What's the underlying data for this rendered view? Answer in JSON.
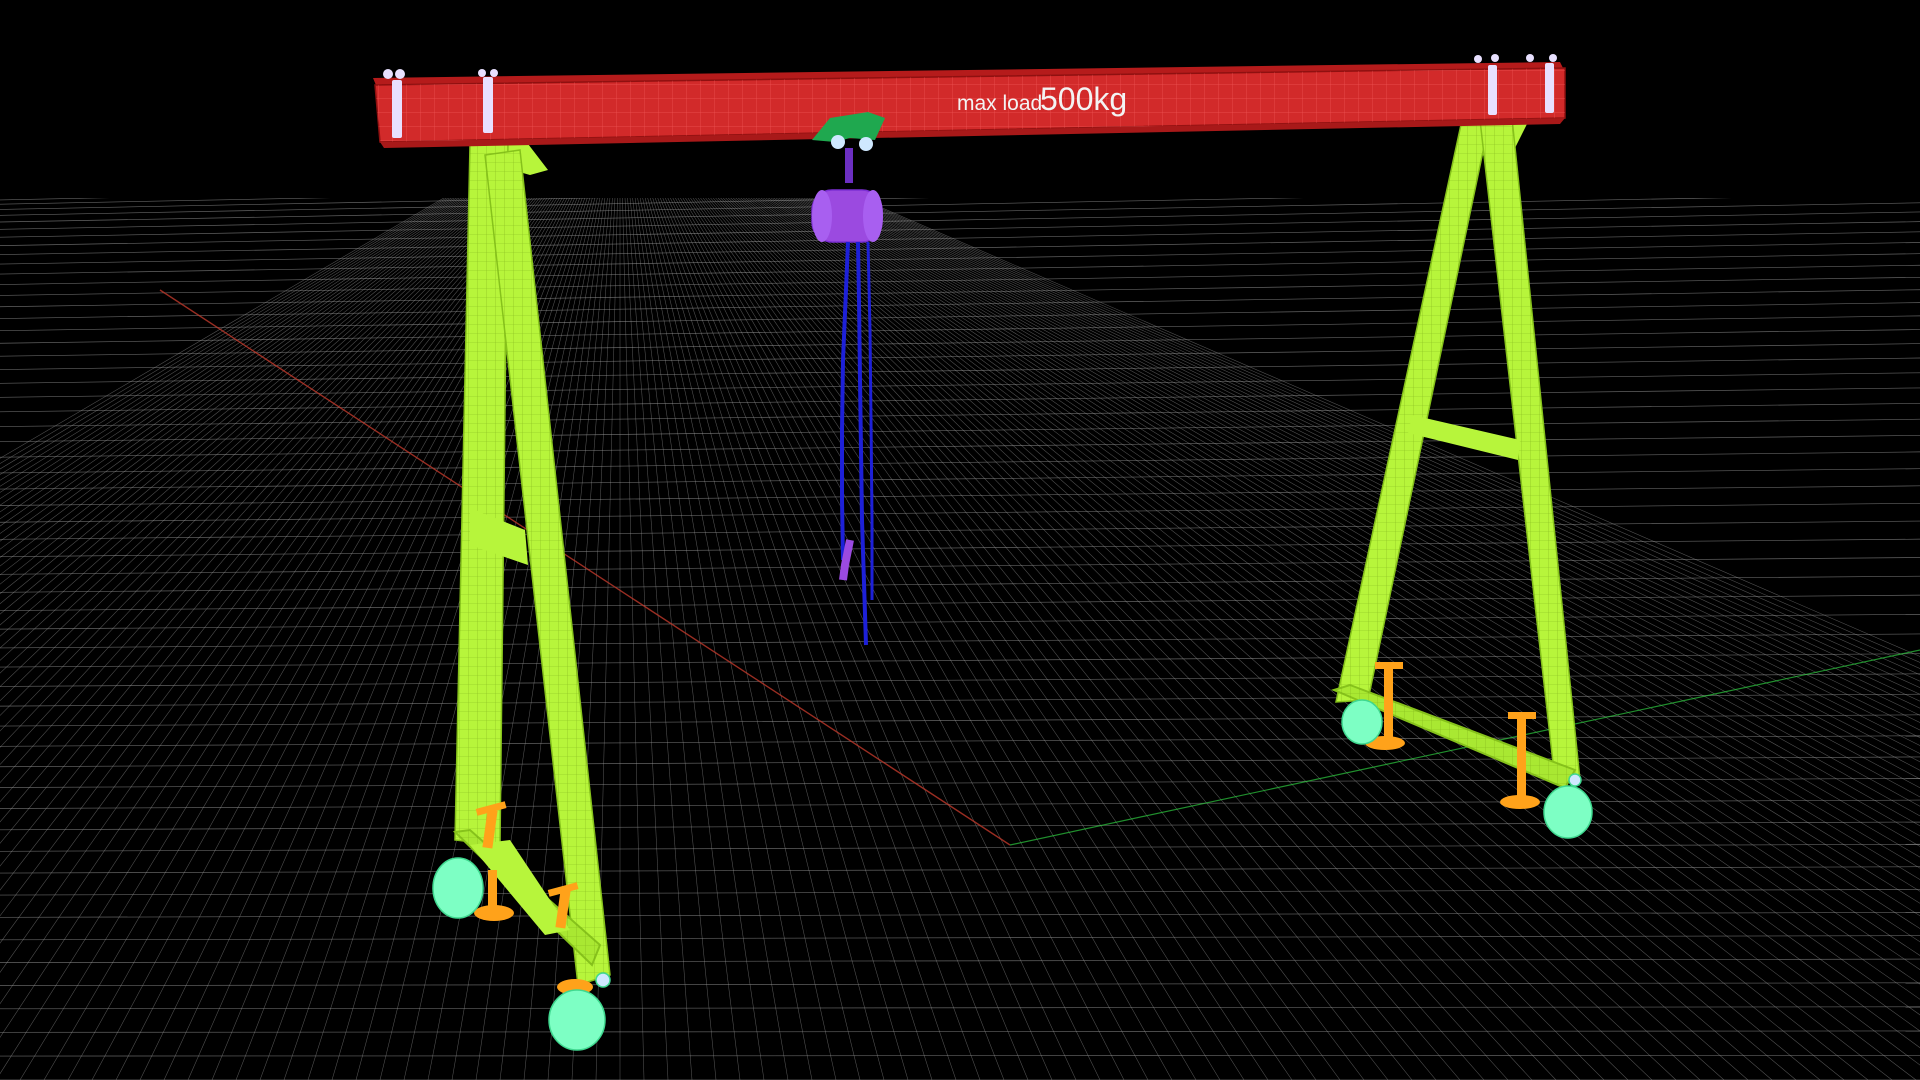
{
  "scene": {
    "title": "",
    "background_color": "#000000",
    "grid": {
      "visible": true,
      "color": "#9a9a9a",
      "x_axis_color": "#c0392b",
      "y_axis_color": "#2ecc40"
    },
    "beam": {
      "label_prefix": "max load",
      "label_value": "500kg",
      "color": "#d22a2a",
      "wire_color": "#ff5555",
      "end_plate_color": "#e8e0ff"
    },
    "frame": {
      "color": "#b7f53b",
      "wire_color": "#d9ff74"
    },
    "trolley": {
      "color": "#1fa84f"
    },
    "hoist": {
      "color": "#9b4ae0",
      "chain_color": "#1d20d8"
    },
    "outriggers": {
      "color": "#ffa21a"
    },
    "casters": {
      "color": "#7dffc4"
    }
  }
}
